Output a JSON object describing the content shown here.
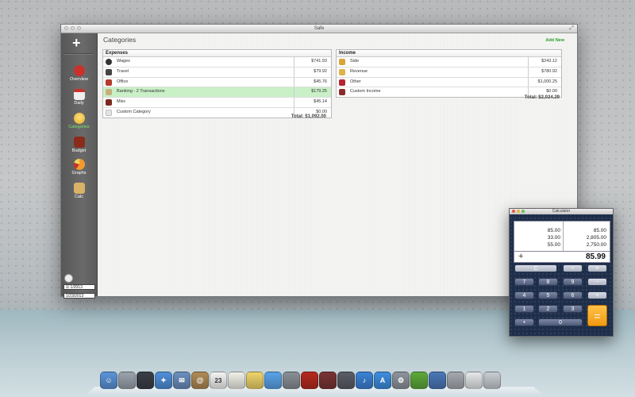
{
  "window": {
    "title": "Safe",
    "resize_glyph": "⤢"
  },
  "sidebar": {
    "add_icon": "plus-icon",
    "items": [
      {
        "label": "Overview",
        "icon": "overview-icon",
        "color": "#c8322b"
      },
      {
        "label": "Daily",
        "icon": "calendar-icon",
        "color": "#e9e9e9"
      },
      {
        "label": "Categories",
        "icon": "lightbulb-icon",
        "color": "#f2c84b",
        "active": true
      },
      {
        "label": "Budget",
        "icon": "briefcase-icon",
        "color": "#8a2b1b"
      },
      {
        "label": "Graphs",
        "icon": "pie-chart-icon",
        "color": "#f29a2e"
      },
      {
        "label": "Calc",
        "icon": "calculator-icon",
        "color": "#d9b267"
      }
    ],
    "date_start": "1/  1/2013",
    "date_end": "1/23/2013"
  },
  "main": {
    "title": "Categories",
    "add_new": "Add New",
    "expenses": {
      "header": "Expenses",
      "rows": [
        {
          "name": "Wages",
          "value": "$741.93",
          "icon_color": "#333"
        },
        {
          "name": "Travel",
          "value": "$79.92",
          "icon_color": "#444"
        },
        {
          "name": "Office",
          "value": "$45.76",
          "icon_color": "#b53a2b"
        },
        {
          "name": "Banking - 2 Transactions",
          "value": "$179.25",
          "icon_color": "#c6b07a",
          "selected": true
        },
        {
          "name": "Misc",
          "value": "$45.14",
          "icon_color": "#7a2a1d"
        },
        {
          "name": "Custom Category",
          "value": "$0.00",
          "icon_color": "#cfcfcf"
        }
      ],
      "total": "Total: $1,092.00"
    },
    "income": {
      "header": "Income",
      "rows": [
        {
          "name": "Side",
          "value": "$243.12",
          "icon_color": "#d9a43a"
        },
        {
          "name": "Revenue",
          "value": "$780.92",
          "icon_color": "#e0b24a"
        },
        {
          "name": "Other",
          "value": "$1,000.25",
          "icon_color": "#b3242f"
        },
        {
          "name": "Custom Income",
          "value": "$0.00",
          "icon_color": "#8c2a2a"
        }
      ],
      "total": "Total: $2,024.29"
    }
  },
  "calculator": {
    "title": "Calculator",
    "tape_left": [
      "85.00",
      "33.00",
      "55.00"
    ],
    "tape_right": [
      "85.00",
      "2,805.00",
      "2,750.00"
    ],
    "operator": "+",
    "result": "85.99",
    "keys": {
      "clear": "C",
      "divide": "÷",
      "multiply": "×",
      "minus": "−",
      "plus": "+",
      "equals": "=",
      "seven": "7",
      "eight": "8",
      "nine": "9",
      "four": "4",
      "five": "5",
      "six": "6",
      "one": "1",
      "two": "2",
      "three": "3",
      "dot": "•",
      "zero": "0"
    }
  },
  "dock": {
    "items": [
      {
        "name": "finder-icon",
        "color": "#5b95d8",
        "glyph": "☺"
      },
      {
        "name": "rocket-icon",
        "color": "#9aa3ad",
        "glyph": ""
      },
      {
        "name": "dashboard-icon",
        "color": "#3a3f47",
        "glyph": ""
      },
      {
        "name": "safari-icon",
        "color": "#4f8fd9",
        "glyph": "✦"
      },
      {
        "name": "mail-icon",
        "color": "#6c8fbf",
        "glyph": "✉"
      },
      {
        "name": "contacts-icon",
        "color": "#b08b56",
        "glyph": "@"
      },
      {
        "name": "calendar-icon",
        "color": "#f5f5f5",
        "glyph": "23"
      },
      {
        "name": "notes-icon",
        "color": "#f1f1e8",
        "glyph": ""
      },
      {
        "name": "stickies-icon",
        "color": "#efd46a",
        "glyph": ""
      },
      {
        "name": "messages-icon",
        "color": "#5aa3e8",
        "glyph": ""
      },
      {
        "name": "facetime-icon",
        "color": "#8a8f97",
        "glyph": ""
      },
      {
        "name": "safe-app-icon",
        "color": "#b52a1f",
        "glyph": ""
      },
      {
        "name": "photo-booth-icon",
        "color": "#7a3434",
        "glyph": ""
      },
      {
        "name": "iphoto-icon",
        "color": "#5a5d67",
        "glyph": ""
      },
      {
        "name": "itunes-icon",
        "color": "#3b82d6",
        "glyph": "♪"
      },
      {
        "name": "app-store-icon",
        "color": "#3e8ee0",
        "glyph": "A"
      },
      {
        "name": "system-preferences-icon",
        "color": "#8e949c",
        "glyph": "⚙"
      },
      {
        "name": "spotify-icon",
        "color": "#5ea93a",
        "glyph": ""
      },
      {
        "name": "xcode-icon",
        "color": "#4b78b8",
        "glyph": ""
      },
      {
        "name": "speaker-icon",
        "color": "#a5a9af",
        "glyph": ""
      },
      {
        "name": "preview-icon",
        "color": "#e6e8ea",
        "glyph": ""
      },
      {
        "name": "trash-icon",
        "color": "#c9ced3",
        "glyph": ""
      }
    ]
  }
}
